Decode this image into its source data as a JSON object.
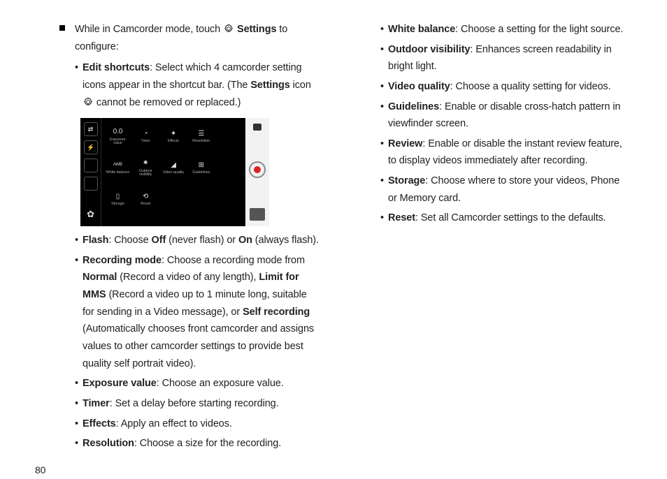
{
  "pageNumber": "80",
  "lead": {
    "prefix": "While in Camcorder mode, touch ",
    "settingsWord": "Settings",
    "suffix": " to configure:"
  },
  "items": {
    "editShortcuts": {
      "label": "Edit shortcuts",
      "text1": ": Select which 4 camcorder setting icons appear in the shortcut bar. (The ",
      "settingsWord": "Settings",
      "text2": " icon ",
      "text3": " cannot be removed or replaced.)"
    },
    "flash": {
      "label": "Flash",
      "t1": ": Choose ",
      "off": "Off",
      "t2": " (never flash) or ",
      "on": "On",
      "t3": " (always flash)."
    },
    "recordingMode": {
      "label": "Recording mode",
      "t1": ": Choose a recording mode from ",
      "normal": "Normal",
      "t2": " (Record a video of any length), ",
      "limit": "Limit for MMS",
      "t3": " (Record a video up to 1 minute long, suitable for sending in a Video message), or ",
      "self": "Self recording",
      "t4": " (Automatically chooses front camcorder and assigns values to other camcorder settings to provide best quality self portrait video)."
    },
    "exposure": {
      "label": "Exposure value",
      "text": ": Choose an exposure value."
    },
    "timer": {
      "label": "Timer",
      "text": ": Set a delay before starting recording."
    },
    "effects": {
      "label": "Effects",
      "text": ": Apply an effect to videos."
    },
    "resolution": {
      "label": "Resolution",
      "text": ": Choose a size for the recording."
    },
    "whiteBalance": {
      "label": "White balance",
      "text": ": Choose a setting for the light source."
    },
    "outdoorVisibility": {
      "label": "Outdoor visibility",
      "text": ": Enhances screen readability in bright light."
    },
    "videoQuality": {
      "label": "Video quality",
      "text": ": Choose a quality setting for videos."
    },
    "guidelines": {
      "label": "Guidelines",
      "text": ": Enable or disable cross-hatch pattern in viewfinder screen."
    },
    "review": {
      "label": "Review",
      "text": ": Enable or disable the instant review feature, to display videos immediately after recording."
    },
    "storage": {
      "label": "Storage",
      "text": ": Choose where to store your videos, Phone or Memory card."
    },
    "reset": {
      "label": "Reset",
      "text": ": Set all Camcorder settings to the defaults."
    }
  },
  "screenshot": {
    "leftIcons": [
      "⇄",
      "⚡",
      "▭",
      "▭"
    ],
    "grid": [
      {
        "icon": "0.0",
        "label": "Exposure value"
      },
      {
        "icon": "◔",
        "label": "Timer"
      },
      {
        "icon": "✦",
        "label": "Effects"
      },
      {
        "icon": "☰",
        "label": "Resolution"
      },
      {
        "icon": "",
        "label": ""
      },
      {
        "icon": "AWB",
        "label": "White balance"
      },
      {
        "icon": "✷",
        "label": "Outdoor visibility"
      },
      {
        "icon": "◢",
        "label": "Video quality"
      },
      {
        "icon": "⊞",
        "label": "Guidelines"
      },
      {
        "icon": "",
        "label": ""
      },
      {
        "icon": "▯",
        "label": "Storage"
      },
      {
        "icon": "⟲",
        "label": "Reset"
      }
    ]
  }
}
